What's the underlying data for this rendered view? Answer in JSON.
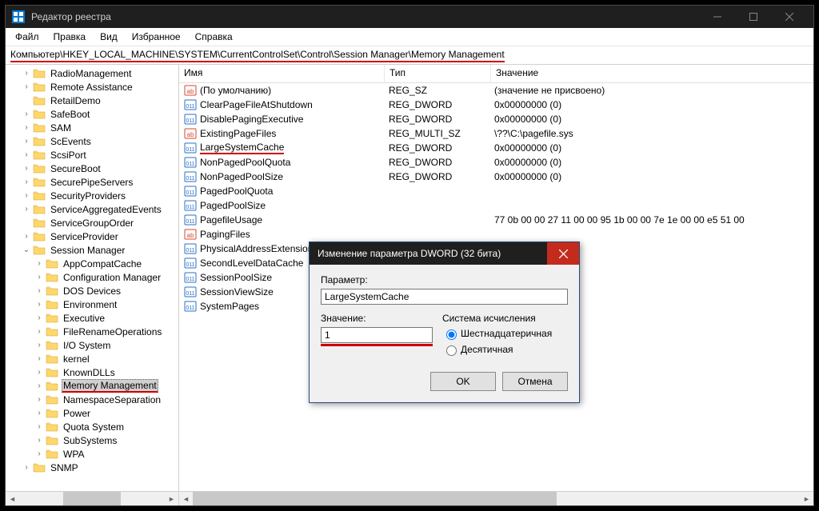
{
  "window": {
    "title": "Редактор реестра"
  },
  "menu": {
    "file": "Файл",
    "edit": "Правка",
    "view": "Вид",
    "favorites": "Избранное",
    "help": "Справка"
  },
  "address": "Компьютер\\HKEY_LOCAL_MACHINE\\SYSTEM\\CurrentControlSet\\Control\\Session Manager\\Memory Management",
  "tree": {
    "l1": [
      {
        "label": "RadioManagement",
        "exp": ">"
      },
      {
        "label": "Remote Assistance",
        "exp": ">"
      },
      {
        "label": "RetailDemo",
        "exp": ""
      },
      {
        "label": "SafeBoot",
        "exp": ">"
      },
      {
        "label": "SAM",
        "exp": ">"
      },
      {
        "label": "ScEvents",
        "exp": ">"
      },
      {
        "label": "ScsiPort",
        "exp": ">"
      },
      {
        "label": "SecureBoot",
        "exp": ">"
      },
      {
        "label": "SecurePipeServers",
        "exp": ">"
      },
      {
        "label": "SecurityProviders",
        "exp": ">"
      },
      {
        "label": "ServiceAggregatedEvents",
        "exp": ">"
      },
      {
        "label": "ServiceGroupOrder",
        "exp": ""
      },
      {
        "label": "ServiceProvider",
        "exp": ">"
      },
      {
        "label": "Session Manager",
        "exp": "v"
      }
    ],
    "l2": [
      {
        "label": "AppCompatCache"
      },
      {
        "label": "Configuration Manager"
      },
      {
        "label": "DOS Devices"
      },
      {
        "label": "Environment"
      },
      {
        "label": "Executive"
      },
      {
        "label": "FileRenameOperations"
      },
      {
        "label": "I/O System"
      },
      {
        "label": "kernel"
      },
      {
        "label": "KnownDLLs"
      },
      {
        "label": "Memory Management"
      },
      {
        "label": "NamespaceSeparation"
      },
      {
        "label": "Power"
      },
      {
        "label": "Quota System"
      },
      {
        "label": "SubSystems"
      },
      {
        "label": "WPA"
      }
    ],
    "after": {
      "label": "SNMP",
      "exp": ">"
    }
  },
  "list": {
    "headers": {
      "name": "Имя",
      "type": "Тип",
      "value": "Значение"
    },
    "rows": [
      {
        "name": "(По умолчанию)",
        "type": "REG_SZ",
        "value": "(значение не присвоено)",
        "icon": "str"
      },
      {
        "name": "ClearPageFileAtShutdown",
        "type": "REG_DWORD",
        "value": "0x00000000 (0)",
        "icon": "bin"
      },
      {
        "name": "DisablePagingExecutive",
        "type": "REG_DWORD",
        "value": "0x00000000 (0)",
        "icon": "bin"
      },
      {
        "name": "ExistingPageFiles",
        "type": "REG_MULTI_SZ",
        "value": "\\??\\C:\\pagefile.sys",
        "icon": "str"
      },
      {
        "name": "LargeSystemCache",
        "type": "REG_DWORD",
        "value": "0x00000000 (0)",
        "icon": "bin",
        "ul": true
      },
      {
        "name": "NonPagedPoolQuota",
        "type": "REG_DWORD",
        "value": "0x00000000 (0)",
        "icon": "bin"
      },
      {
        "name": "NonPagedPoolSize",
        "type": "REG_DWORD",
        "value": "0x00000000 (0)",
        "icon": "bin"
      },
      {
        "name": "PagedPoolQuota",
        "type": "",
        "value": "",
        "icon": "bin"
      },
      {
        "name": "PagedPoolSize",
        "type": "",
        "value": "",
        "icon": "bin"
      },
      {
        "name": "PagefileUsage",
        "type": "",
        "value": "77 0b 00 00 27 11 00 00 95 1b 00 00 7e 1e 00 00 e5 51 00",
        "icon": "bin"
      },
      {
        "name": "PagingFiles",
        "type": "",
        "value": "",
        "icon": "str"
      },
      {
        "name": "PhysicalAddressExtension",
        "type": "",
        "value": "",
        "icon": "bin"
      },
      {
        "name": "SecondLevelDataCache",
        "type": "",
        "value": "",
        "icon": "bin"
      },
      {
        "name": "SessionPoolSize",
        "type": "",
        "value": "",
        "icon": "bin"
      },
      {
        "name": "SessionViewSize",
        "type": "",
        "value": "",
        "icon": "bin"
      },
      {
        "name": "SystemPages",
        "type": "",
        "value": "",
        "icon": "bin"
      }
    ]
  },
  "dialog": {
    "title": "Изменение параметра DWORD (32 бита)",
    "param_label": "Параметр:",
    "param_value": "LargeSystemCache",
    "value_label": "Значение:",
    "value_value": "1",
    "base_label": "Система исчисления",
    "hex": "Шестнадцатеричная",
    "dec": "Десятичная",
    "ok": "OK",
    "cancel": "Отмена"
  }
}
